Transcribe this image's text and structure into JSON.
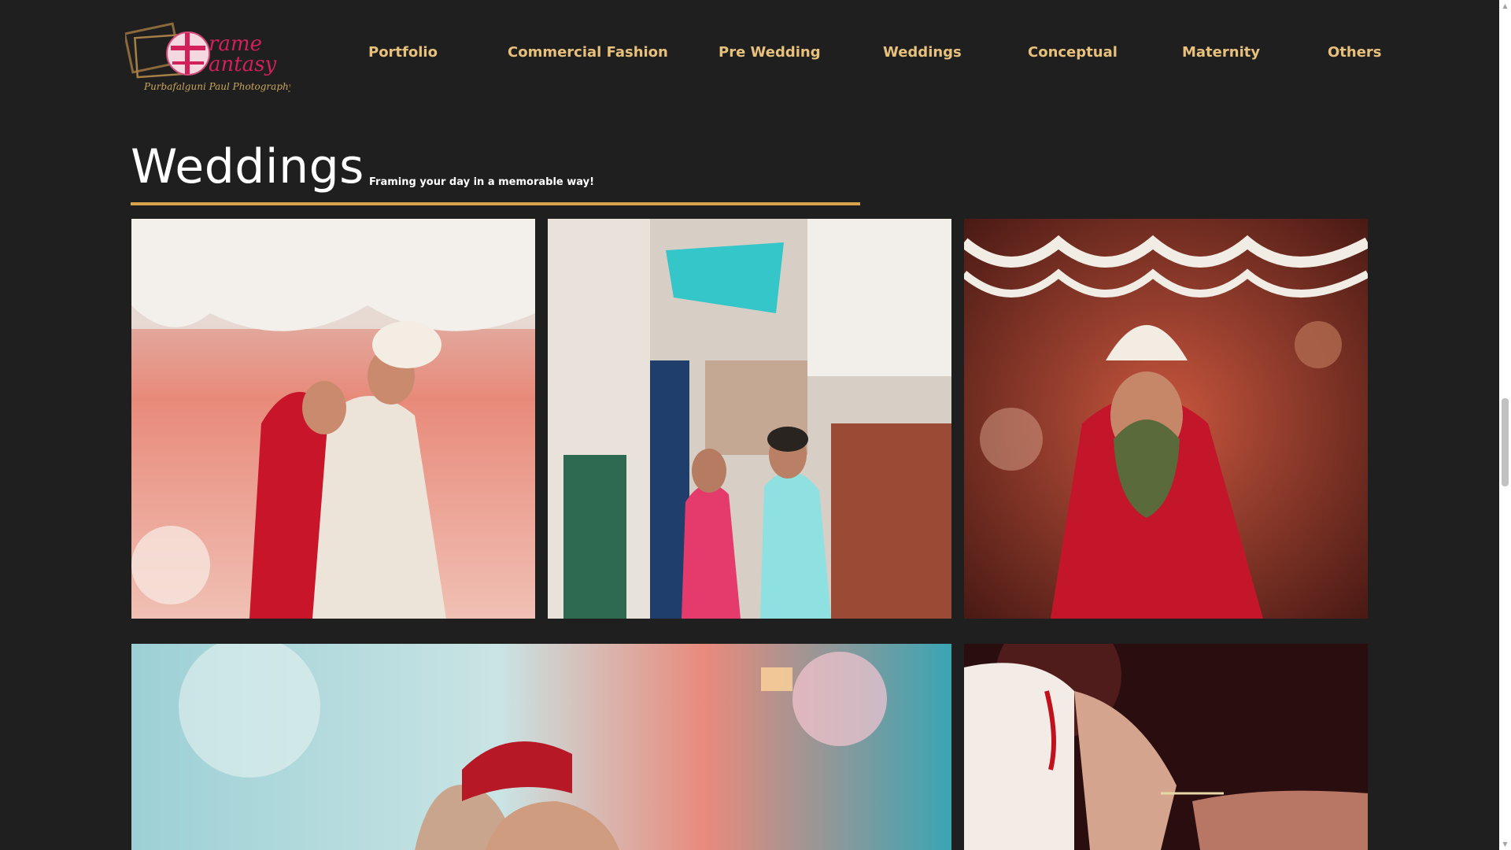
{
  "brand": {
    "logo_lettering": "Frame Fantasy — Purbafalguni Paul Photography"
  },
  "nav": {
    "items": [
      {
        "label": "Portfolio"
      },
      {
        "label": "Commercial Fashion"
      },
      {
        "label": "Pre Wedding"
      },
      {
        "label": "Weddings"
      },
      {
        "label": "Conceptual"
      },
      {
        "label": "Maternity"
      },
      {
        "label": "Others"
      }
    ]
  },
  "page": {
    "title": "Weddings",
    "subtitle": "Framing your day in a memorable way!"
  },
  "colors": {
    "background": "#1f1f1f",
    "nav_text": "#e7c07c",
    "accent_rule": "#d9a34b",
    "title_text": "#ffffff"
  },
  "gallery": {
    "photos": [
      {
        "name": "photo-bride-groom-floral"
      },
      {
        "name": "photo-couple-alley"
      },
      {
        "name": "photo-bride-betel-leaf"
      },
      {
        "name": "photo-couple-pink-blossom"
      },
      {
        "name": "photo-hands-ritual"
      }
    ]
  }
}
